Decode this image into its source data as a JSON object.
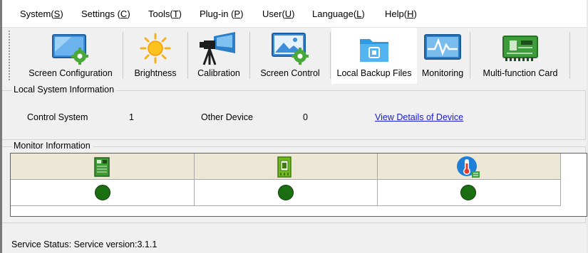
{
  "menu": [
    {
      "label": "System(",
      "acc": "S",
      "end": ")"
    },
    {
      "label": "Settings (",
      "acc": "C",
      "end": ")"
    },
    {
      "label": "Tools(",
      "acc": "T",
      "end": ")"
    },
    {
      "label": "Plug-in (",
      "acc": "P",
      "end": ")"
    },
    {
      "label": "User(",
      "acc": "U",
      "end": ")"
    },
    {
      "label": "Language(",
      "acc": "L",
      "end": ")"
    },
    {
      "label": "Help(",
      "acc": "H",
      "end": ")"
    }
  ],
  "toolbar": {
    "items": [
      {
        "label": "Screen Configuration",
        "icon": "screen-config-icon"
      },
      {
        "label": "Brightness",
        "icon": "sun-icon"
      },
      {
        "label": "Calibration",
        "icon": "camera-icon"
      },
      {
        "label": "Screen Control",
        "icon": "screen-control-icon"
      },
      {
        "label": "Local Backup Files",
        "icon": "folder-icon"
      },
      {
        "label": "Monitoring",
        "icon": "monitor-wave-icon"
      },
      {
        "label": "Multi-function Card",
        "icon": "circuit-card-icon"
      }
    ]
  },
  "local_info": {
    "title": "Local System Information",
    "control_label": "Control System",
    "control_value": "1",
    "other_label": "Other Device",
    "other_value": "0",
    "details_link": "View Details of Device"
  },
  "monitor": {
    "title": "Monitor Information",
    "columns": [
      {
        "icon": "receiving-card-icon",
        "status": "ok"
      },
      {
        "icon": "control-card-icon",
        "status": "ok"
      },
      {
        "icon": "thermometer-icon",
        "status": "ok"
      }
    ],
    "status_color": "#1b6e12"
  },
  "status": {
    "label": "Service Status:",
    "value": "Service version:3.1.1"
  }
}
